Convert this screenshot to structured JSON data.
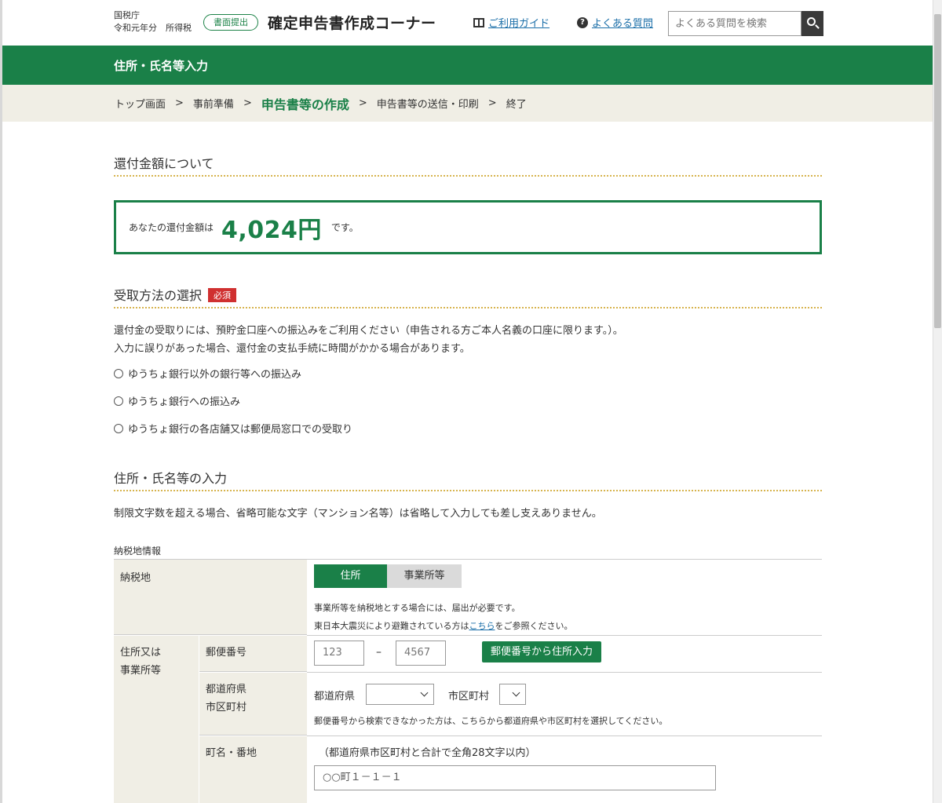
{
  "header": {
    "agency_line1": "国税庁",
    "agency_line2": "令和元年分　所得税",
    "submit_pill": "書面提出",
    "site_title": "確定申告書作成コーナー",
    "guide_link": "ご利用ガイド",
    "faq_link": "よくある質問",
    "search_placeholder": "よくある質問を検索"
  },
  "page_title": "住所・氏名等入力",
  "breadcrumb": [
    "トップ画面",
    "事前準備",
    "申告書等の作成",
    "申告書等の送信・印刷",
    "終了"
  ],
  "breadcrumb_sep": ">",
  "refund": {
    "section_title": "還付金額について",
    "pre": "あなたの還付金額は",
    "amount": "4,024円",
    "post": "です。"
  },
  "receipt": {
    "section_title": "受取方法の選択",
    "required_badge": "必須",
    "line1": "還付金の受取りには、預貯金口座への振込みをご利用ください（申告される方ご本人名義の口座に限ります。）。",
    "line2": "入力に誤りがあった場合、還付金の支払手続に時間がかかる場合があります。",
    "options": [
      "ゆうちょ銀行以外の銀行等への振込み",
      "ゆうちょ銀行への振込み",
      "ゆうちょ銀行の各店舗又は郵便局窓口での受取り"
    ]
  },
  "address": {
    "section_title": "住所・氏名等の入力",
    "note": "制限文字数を超える場合、省略可能な文字（マンション名等）は省略して入力しても差し支えありません。",
    "caption": "納税地情報",
    "row_nozeichi": "納税地",
    "seg_on": "住所",
    "seg_off": "事業所等",
    "note1": "事業所等を納税地とする場合には、届出が必要です。",
    "note2_pre": "東日本大震災により避難されている方は",
    "note2_link": "こちら",
    "note2_post": "をご参照ください。",
    "row_group": [
      "住所又は",
      "事業所等"
    ],
    "row_zip": "郵便番号",
    "zip1_placeholder": "123",
    "zip_dash": "–",
    "zip2_placeholder": "4567",
    "zip_button": "郵便番号から住所入力",
    "row_pref": [
      "都道府県",
      "市区町村"
    ],
    "pref_label": "都道府県",
    "city_label": "市区町村",
    "pref_note": "郵便番号から検索できなかった方は、こちらから都道府県や市区町村を選択してください。",
    "row_town": "町名・番地",
    "town_note": "（都道府県市区町村と合計で全角28文字以内）",
    "town_placeholder": "○○町１－１－１"
  },
  "colors": {
    "brand_green": "#1a8048",
    "required_red": "#d03030",
    "link_blue": "#1a6ea8",
    "label_bg": "#f0eee5"
  }
}
